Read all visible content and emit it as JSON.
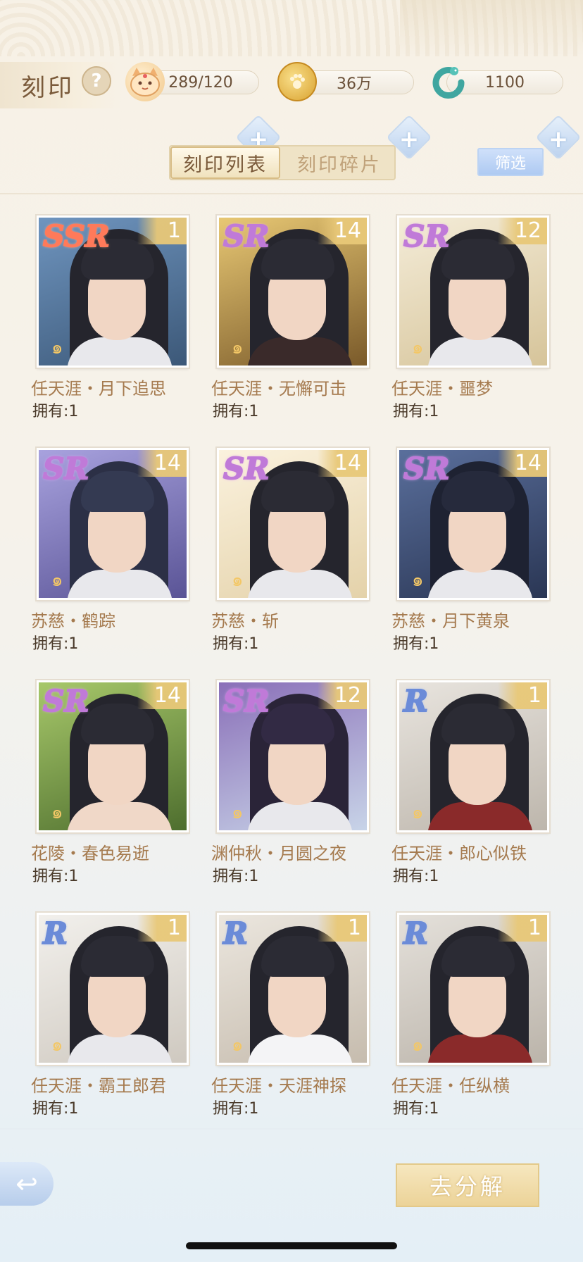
{
  "header": {
    "title": "刻印",
    "help_symbol": "?",
    "resources": [
      {
        "name": "cat-stamina",
        "icon": "cat-face-icon",
        "value": "289/120"
      },
      {
        "name": "coin",
        "icon": "paw-coin-icon",
        "value": "36万"
      },
      {
        "name": "jade",
        "icon": "jade-dragon-icon",
        "value": "1100"
      }
    ],
    "plus_symbol": "+"
  },
  "tabs": [
    {
      "label": "刻印列表",
      "active": true
    },
    {
      "label": "刻印碎片",
      "active": false
    }
  ],
  "filter_label": "筛选",
  "owned_prefix": "拥有:",
  "cards": [
    {
      "rarity": "SSR",
      "level": "1",
      "name": "任天涯・月下追思",
      "owned": "拥有:1",
      "bg": "#5a7fa6"
    },
    {
      "rarity": "SR",
      "level": "14",
      "name": "任天涯・无懈可击",
      "owned": "拥有:1",
      "bg": "#c9a25a"
    },
    {
      "rarity": "SR",
      "level": "12",
      "name": "任天涯・噩梦",
      "owned": "拥有:1",
      "bg": "#e7dcc2"
    },
    {
      "rarity": "SR",
      "level": "14",
      "name": "苏慈・鹤踪",
      "owned": "拥有:1",
      "bg": "#8c86c6"
    },
    {
      "rarity": "SR",
      "level": "14",
      "name": "苏慈・斩",
      "owned": "拥有:1",
      "bg": "#efe4cf"
    },
    {
      "rarity": "SR",
      "level": "14",
      "name": "苏慈・月下黄泉",
      "owned": "拥有:1",
      "bg": "#3f4f74"
    },
    {
      "rarity": "SR",
      "level": "14",
      "name": "花陵・春色易逝",
      "owned": "拥有:1",
      "bg": "#7fa24c"
    },
    {
      "rarity": "SR",
      "level": "12",
      "name": "渊仲秋・月圆之夜",
      "owned": "拥有:1",
      "bg": "#6f5a94"
    },
    {
      "rarity": "R",
      "level": "1",
      "name": "任天涯・郎心似铁",
      "owned": "拥有:1",
      "bg": "#d9d6d2"
    },
    {
      "rarity": "R",
      "level": "1",
      "name": "任天涯・霸王郎君",
      "owned": "拥有:1",
      "bg": "#e6e3df"
    },
    {
      "rarity": "R",
      "level": "1",
      "name": "任天涯・天涯神探",
      "owned": "拥有:1",
      "bg": "#dcd6cd"
    },
    {
      "rarity": "R",
      "level": "1",
      "name": "任天涯・任纵横",
      "owned": "拥有:1",
      "bg": "#d4d0cc"
    }
  ],
  "bottom": {
    "back_symbol": "↩",
    "decompose_label": "去分解"
  }
}
